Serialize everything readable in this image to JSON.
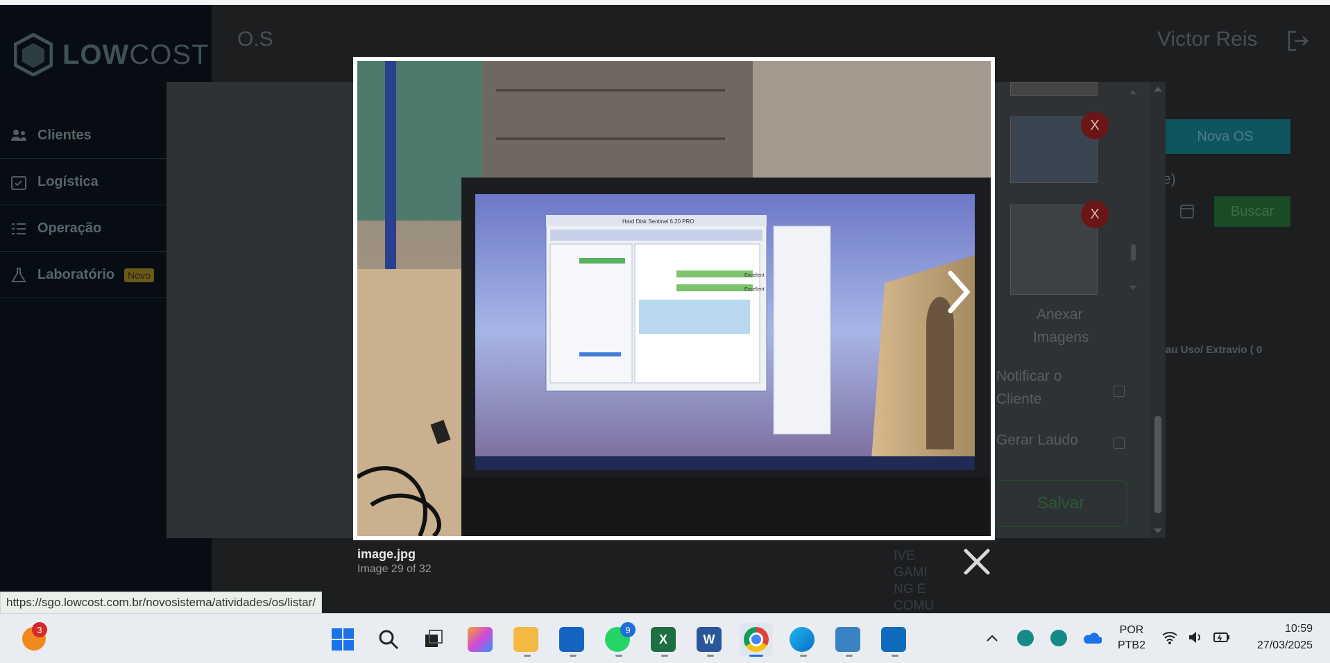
{
  "app": {
    "brand_bold": "LOW",
    "brand_light": "COST",
    "page_title": "O.S",
    "user_name": "Victor Reis"
  },
  "sidebar": {
    "items": [
      {
        "label": "Clientes",
        "icon": "users-icon"
      },
      {
        "label": "Logística",
        "icon": "calendar-check-icon"
      },
      {
        "label": "Operação",
        "icon": "list-icon"
      },
      {
        "label": "Laboratório",
        "icon": "flask-icon",
        "badge": "Novo"
      }
    ]
  },
  "background_modal": {
    "attach_label_1": "Anexar",
    "attach_label_2": "Imagens",
    "notify_label_1": "Notificar o",
    "notify_label_2": "Cliente",
    "report_label": "Gerar Laudo",
    "save_label": "Salvar",
    "remove_label": "X",
    "new_os_label": "Nova OS",
    "search_label": "Buscar",
    "partial_text": "au Uso/ Extravio ( 0",
    "partial_paren": "e)",
    "behind_text": "IVE GAMI NG E COMU"
  },
  "lightbox": {
    "file_name": "image.jpg",
    "counter": "Image 29 of 32",
    "photo_screen_window_title": "Hard Disk Sentinel 6.20 PRO",
    "photo_screen_status_1": "Excellent",
    "photo_screen_status_2": "Excellent"
  },
  "status_url": "https://sgo.lowcost.com.br/novosistema/atividades/os/listar/",
  "taskbar": {
    "notification_count": "3",
    "whatsapp_count": "9",
    "excel_letter": "X",
    "word_letter": "W",
    "language_1": "POR",
    "language_2": "PTB2",
    "time": "10:59",
    "date": "27/03/2025"
  },
  "colors": {
    "accent_green": "#1e7e34",
    "accent_teal": "#17a2b8",
    "danger_red": "#c82333"
  }
}
